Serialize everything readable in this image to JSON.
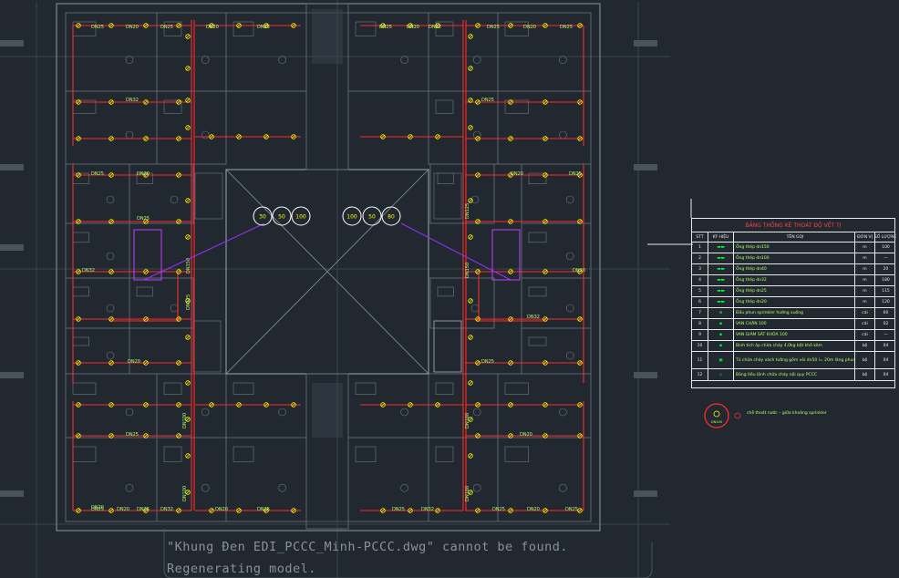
{
  "drawing": {
    "room_tags_top_left": [
      "DN25",
      "DN20",
      "DN25",
      "DN20",
      "DN25"
    ],
    "room_tags_top_right": [
      "DN25",
      "DN20",
      "DN32",
      "DN25",
      "DN20",
      "DN25"
    ],
    "room_tags_mid_left": [
      "DN32",
      "DN25",
      "DN20",
      "DN32",
      "DN25",
      "DN20",
      "DN25",
      "DN20"
    ],
    "room_tags_mid_right": [
      "DN25",
      "DN20",
      "DN25",
      "DN20",
      "DN32",
      "DN25",
      "DN20"
    ],
    "room_tags_bottom_left": [
      "DN25",
      "DN20",
      "DN25",
      "DN32",
      "DN20",
      "DN25"
    ],
    "room_tags_bottom_right": [
      "DN25",
      "DN32",
      "DN25",
      "DN20",
      "DN25"
    ],
    "riser_tags_left": [
      "DN150",
      "DN125",
      "DN100",
      "DN100"
    ],
    "riser_tags_right": [
      "DN125",
      "DN150",
      "DN100",
      "DN100"
    ],
    "bubbles_left": [
      "30",
      "50",
      "100"
    ],
    "bubbles_right": [
      "100",
      "50",
      "80"
    ]
  },
  "legend": {
    "title": "BẢNG THỐNG KÊ THOÁT ĐỘ VẾT TỊ",
    "columns": [
      "STT",
      "KÝ HIỆU",
      "TÊN GỌI",
      "ĐƠN VỊ",
      "SỐ LƯỢNG"
    ],
    "rows": [
      {
        "stt": "1",
        "sym": "▬▬",
        "desc": "Ống thép dn150",
        "unit": "m",
        "qty": "100"
      },
      {
        "stt": "2",
        "sym": "▬▬",
        "desc": "Ống thép dn100",
        "unit": "m",
        "qty": "—"
      },
      {
        "stt": "3",
        "sym": "▬▬",
        "desc": "Ống thép dn40",
        "unit": "m",
        "qty": "20"
      },
      {
        "stt": "4",
        "sym": "▬▬",
        "desc": "Ống thép dn32",
        "unit": "m",
        "qty": "180"
      },
      {
        "stt": "5",
        "sym": "▬▬",
        "desc": "Ống thép dn25",
        "unit": "m",
        "qty": "115"
      },
      {
        "stt": "6",
        "sym": "▬▬",
        "desc": "Ống thép dn20",
        "unit": "m",
        "qty": "120"
      },
      {
        "stt": "7",
        "sym": "⊗",
        "desc": "Đầu phun sprinkler hướng xuống",
        "unit": "cái",
        "qty": "60"
      },
      {
        "stt": "8",
        "sym": "▪",
        "desc": "VAN CHẶN 100",
        "unit": "cái",
        "qty": "02"
      },
      {
        "stt": "9",
        "sym": "▪",
        "desc": "VAN GIÁM SÁT KHÓA 100",
        "unit": "cái",
        "qty": "—"
      },
      {
        "stt": "10",
        "sym": "▪",
        "desc": "Bình tích áp chữa cháy 4,0kg bột khô kèm",
        "unit": "bộ",
        "qty": "04"
      },
      {
        "stt": "11",
        "sym": "▣",
        "desc": "Tủ chữa cháy vách tường gồm vòi dn50 l= 20m lăng phun, họng nước",
        "unit": "bộ",
        "qty": "04"
      },
      {
        "stt": "12",
        "sym": "◇",
        "desc": "Bảng tiêu lệnh chữa cháy nội quy PCCC",
        "unit": "bộ",
        "qty": "04"
      }
    ]
  },
  "note": {
    "symbol_label": "DN100",
    "text": "chỗ thoát nước – giữa khoảng sprinkler"
  },
  "status": {
    "line1": "\"Khung Đen EDI_PCCC_Minh-PCCC.dwg\" cannot be found.",
    "line2": "Regenerating model."
  },
  "colors": {
    "background": "#212830",
    "wall": "#5a6470",
    "pipe_red": "#ff2a2a",
    "tag_green": "#b7ff70",
    "sprinkler_yellow": "#ffff00",
    "purple": "#9b30ff",
    "white": "#e8e8e8"
  }
}
